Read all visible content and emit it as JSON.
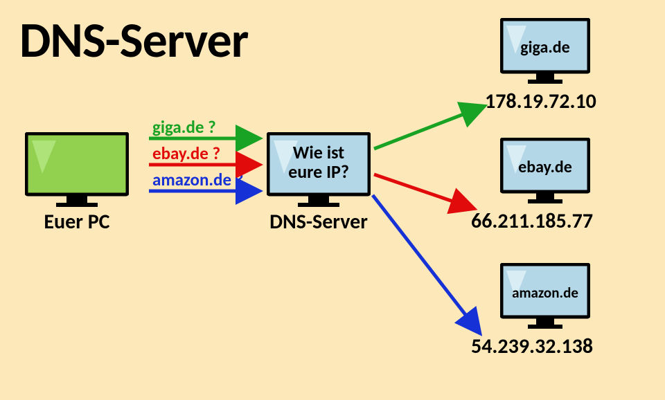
{
  "title": "DNS-Server",
  "pc": {
    "label": "Euer PC"
  },
  "dns": {
    "label": "DNS-Server",
    "screen_text": "Wie ist eure IP?"
  },
  "queries": {
    "giga": {
      "text": "giga.de ?",
      "color": "#19a324"
    },
    "ebay": {
      "text": "ebay.de ?",
      "color": "#e20b0b"
    },
    "amazon": {
      "text": "amazon.de ?",
      "color": "#1631d6"
    }
  },
  "targets": {
    "giga": {
      "host": "giga.de",
      "ip": "178.19.72.10"
    },
    "ebay": {
      "host": "ebay.de",
      "ip": "66.211.185.77"
    },
    "amazon": {
      "host": "amazon.de",
      "ip": "54.239.32.138"
    }
  },
  "palette": {
    "bg": "#fce8b8",
    "green": "#19a324",
    "red": "#e20b0b",
    "blue": "#1631d6",
    "pc_screen": "#92d050",
    "srv_screen": "#b4d7e8"
  }
}
